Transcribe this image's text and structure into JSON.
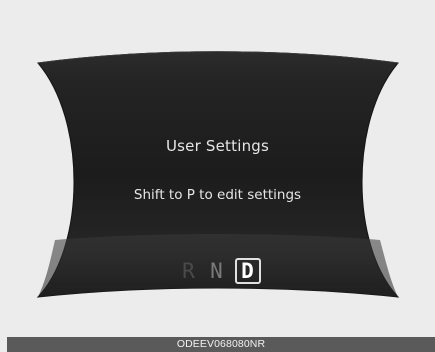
{
  "display": {
    "title": "User Settings",
    "message": "Shift to P to edit settings"
  },
  "gear_selector": {
    "gears": [
      {
        "label": "R",
        "state": "inactive"
      },
      {
        "label": "N",
        "state": "inactive"
      },
      {
        "label": "D",
        "state": "selected"
      }
    ]
  },
  "caption": "ODEEV068080NR",
  "colors": {
    "background": "#ececec",
    "panel": "#1b1b1b",
    "text": "#e6e6e6",
    "caption_bar": "#5a5a5a"
  }
}
